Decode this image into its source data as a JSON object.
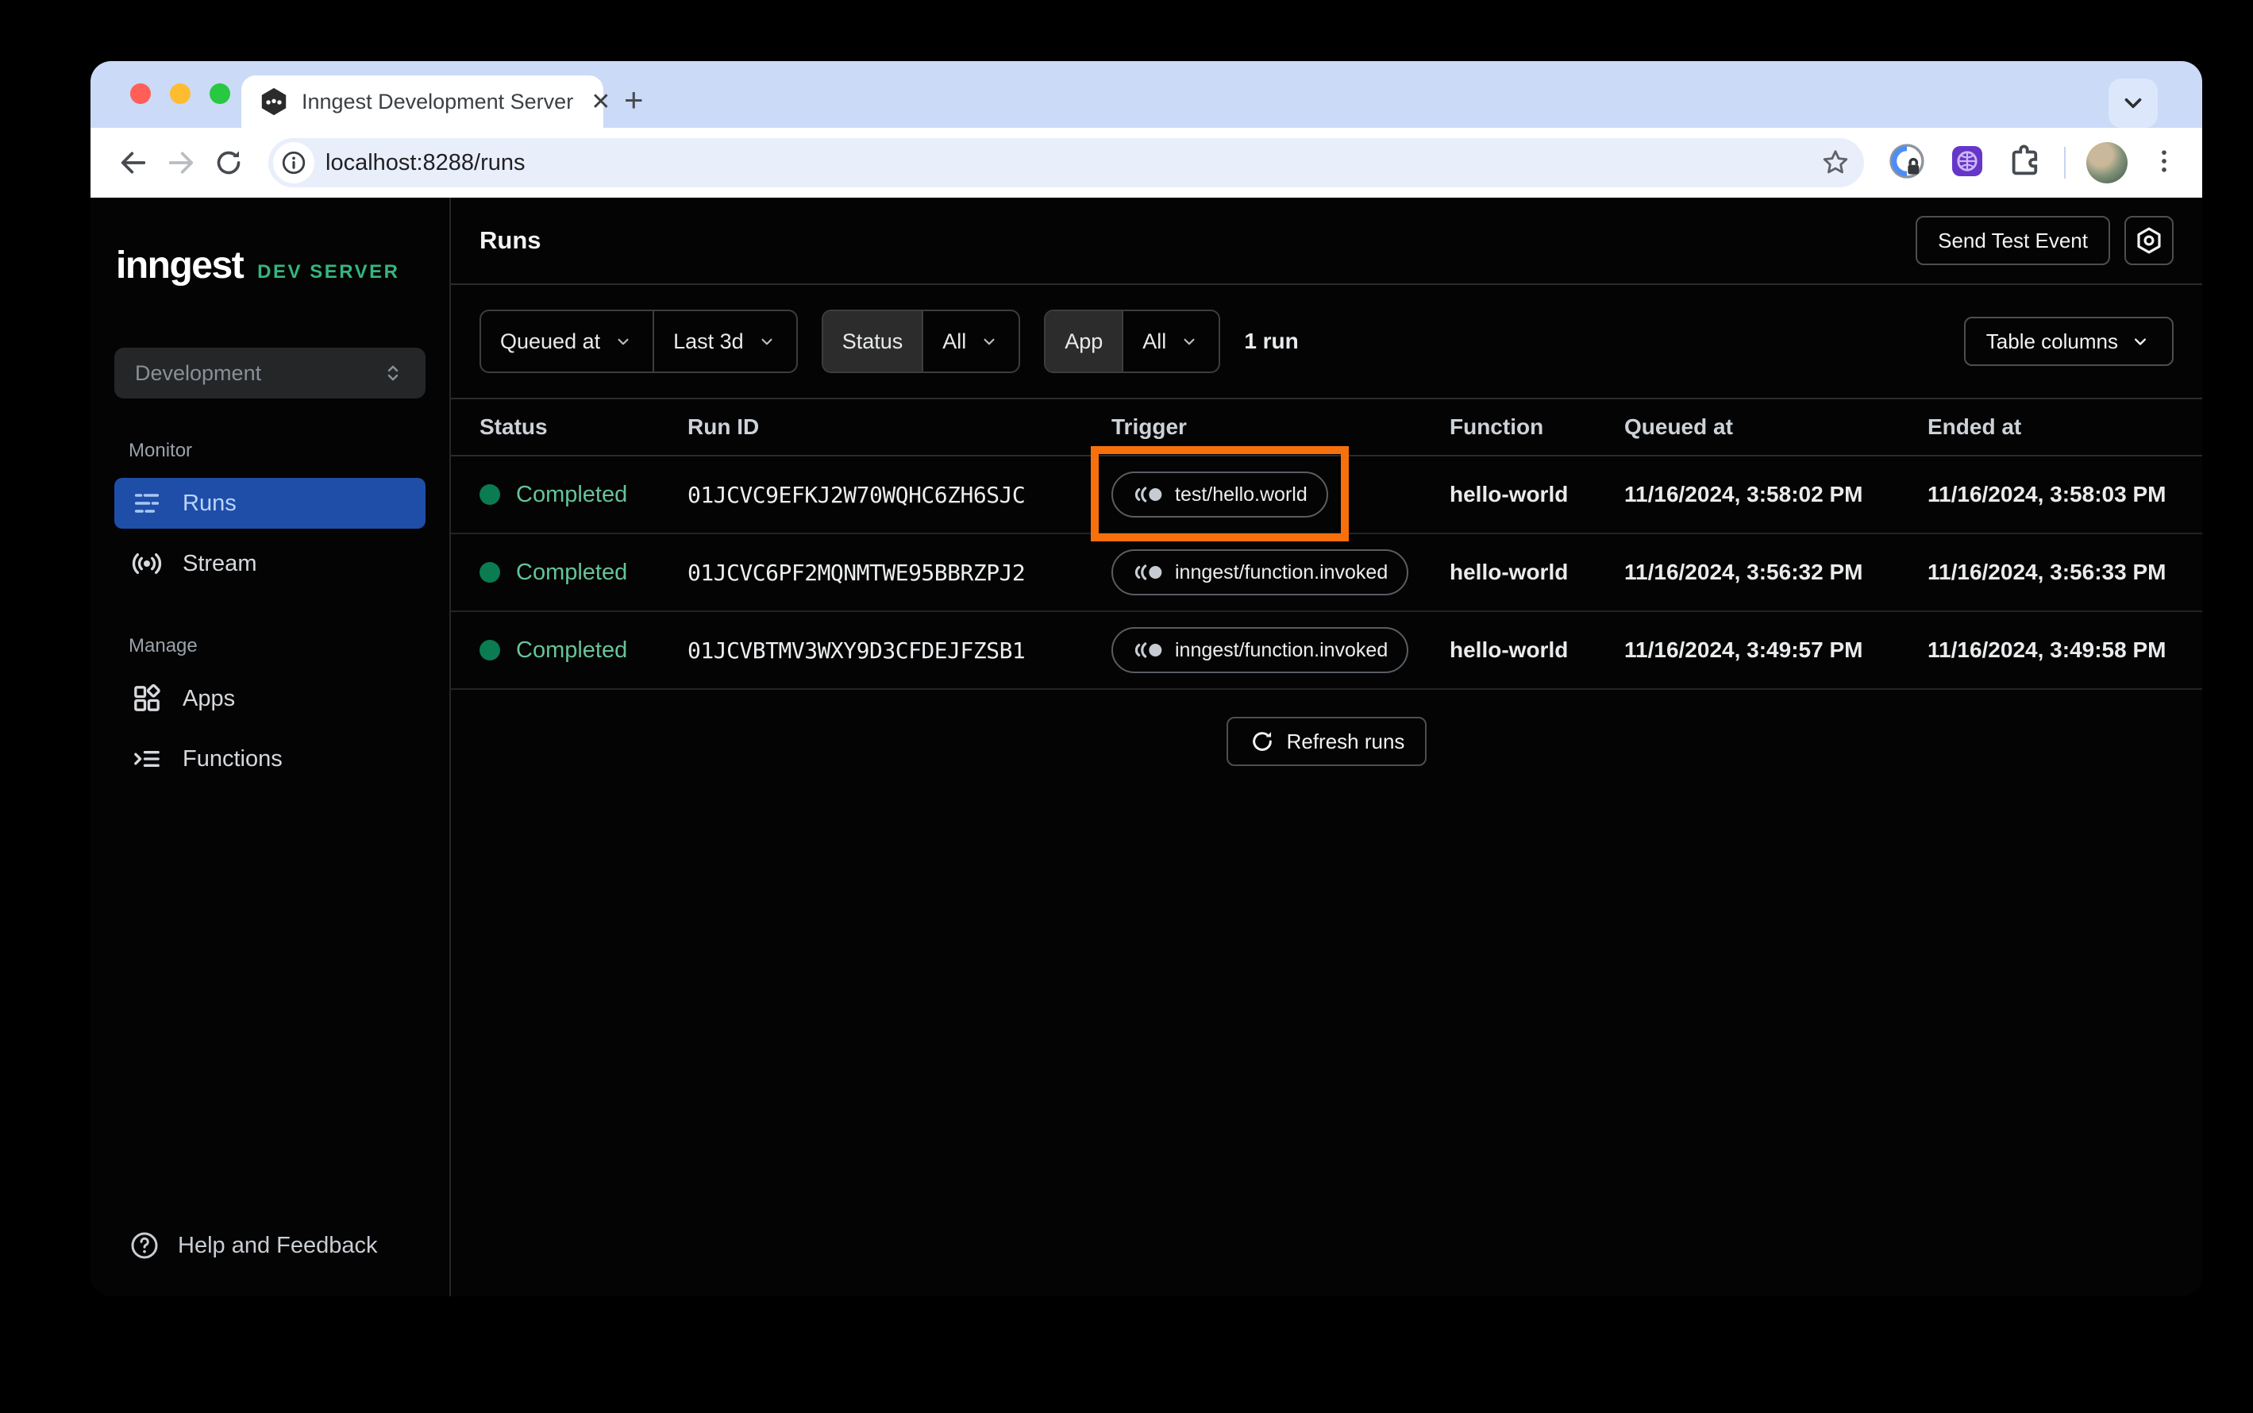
{
  "browser": {
    "tab_title": "Inngest Development Server",
    "url": "localhost:8288/runs"
  },
  "sidebar": {
    "logo_text": "inngest",
    "logo_badge": "DEV SERVER",
    "environment": "Development",
    "sections": [
      {
        "label": "Monitor",
        "items": [
          {
            "label": "Runs"
          },
          {
            "label": "Stream"
          }
        ]
      },
      {
        "label": "Manage",
        "items": [
          {
            "label": "Apps"
          },
          {
            "label": "Functions"
          }
        ]
      }
    ],
    "help_label": "Help and Feedback"
  },
  "header": {
    "title": "Runs",
    "send_test_event_label": "Send Test Event"
  },
  "filters": {
    "queued_at_label": "Queued at",
    "time_range_value": "Last 3d",
    "status_label": "Status",
    "status_value": "All",
    "app_label": "App",
    "app_value": "All",
    "run_count": "1 run",
    "table_columns_label": "Table columns"
  },
  "table": {
    "columns": [
      "Status",
      "Run ID",
      "Trigger",
      "Function",
      "Queued at",
      "Ended at"
    ],
    "rows": [
      {
        "status": "Completed",
        "run_id": "01JCVC9EFKJ2W70WQHC6ZH6SJC",
        "trigger": "test/hello.world",
        "function": "hello-world",
        "queued_at": "11/16/2024, 3:58:02 PM",
        "ended_at": "11/16/2024, 3:58:03 PM",
        "highlighted": true
      },
      {
        "status": "Completed",
        "run_id": "01JCVC6PF2MQNMTWE95BBRZPJ2",
        "trigger": "inngest/function.invoked",
        "function": "hello-world",
        "queued_at": "11/16/2024, 3:56:32 PM",
        "ended_at": "11/16/2024, 3:56:33 PM",
        "highlighted": false
      },
      {
        "status": "Completed",
        "run_id": "01JCVBTMV3WXY9D3CFDEJFZSB1",
        "trigger": "inngest/function.invoked",
        "function": "hello-world",
        "queued_at": "11/16/2024, 3:49:57 PM",
        "ended_at": "11/16/2024, 3:49:58 PM",
        "highlighted": false
      }
    ],
    "refresh_label": "Refresh runs"
  },
  "colors": {
    "accent_blue": "#1e4ea8",
    "status_dot_green": "#0b7b52",
    "status_text_green": "#67c398",
    "dev_green": "#35b57f",
    "highlight_orange": "#f8700c",
    "chrome_strip": "#cbdaf7",
    "chrome_pill": "#e9eefb",
    "chrome_chip": "#dde7fb"
  }
}
